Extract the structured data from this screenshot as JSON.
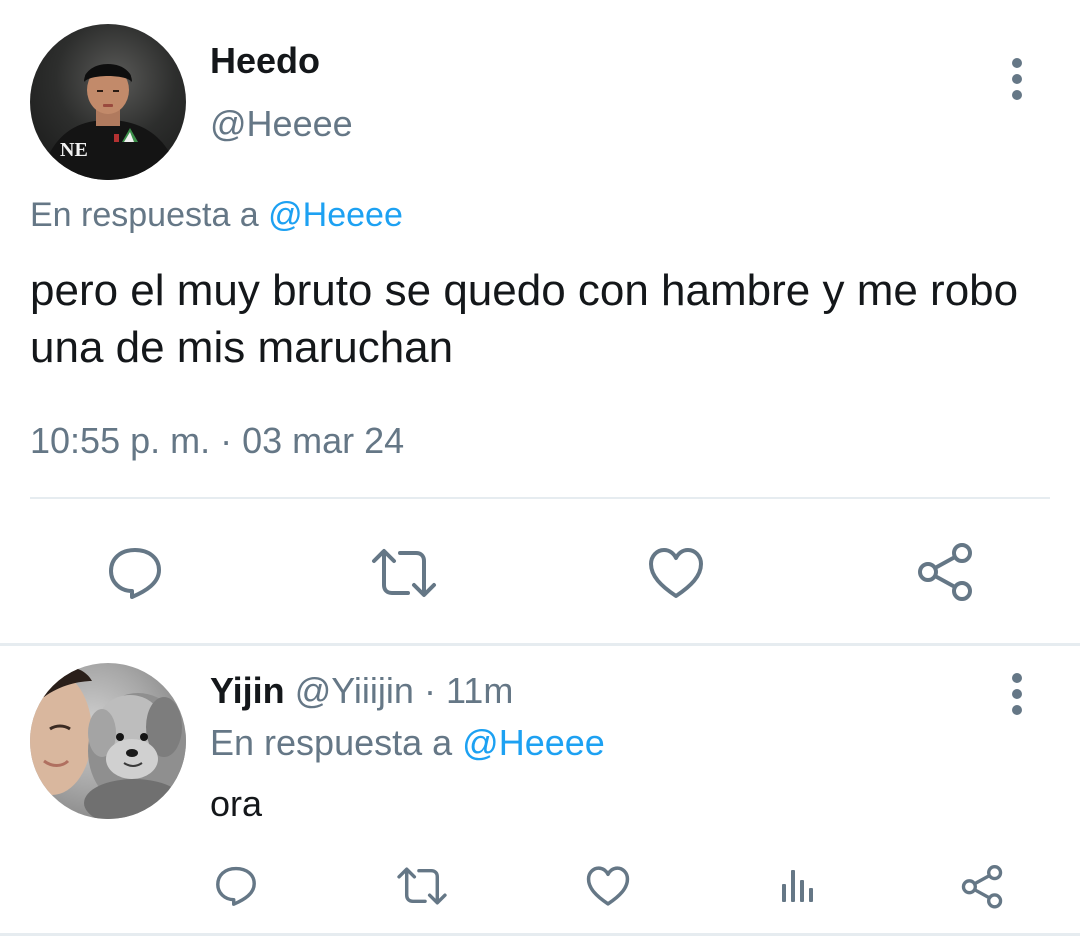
{
  "main_tweet": {
    "author_name": "Heedo",
    "author_handle": "@Heeee",
    "replying_prefix": "En respuesta a",
    "replying_to": "@Heeee",
    "text": "pero el muy bruto se quedo con hambre y me robo una de mis maruchan",
    "timestamp": "10:55 p. m. · 03 mar 24",
    "avatar_text": "NE",
    "actions": [
      "reply-icon",
      "retweet-icon",
      "like-icon",
      "share-icon"
    ]
  },
  "reply_tweet": {
    "author_name": "Yijin",
    "author_handle": "@Yiiijin",
    "separator": "·",
    "time_ago": "11m",
    "replying_prefix": "En respuesta a",
    "replying_to": "@Heeee",
    "text": "ora",
    "actions": [
      "reply-icon",
      "retweet-icon",
      "like-icon",
      "analytics-icon",
      "share-icon"
    ]
  },
  "colors": {
    "text": "#14171a",
    "muted": "#657786",
    "link": "#1da1f2",
    "divider": "#e6ecf0"
  }
}
